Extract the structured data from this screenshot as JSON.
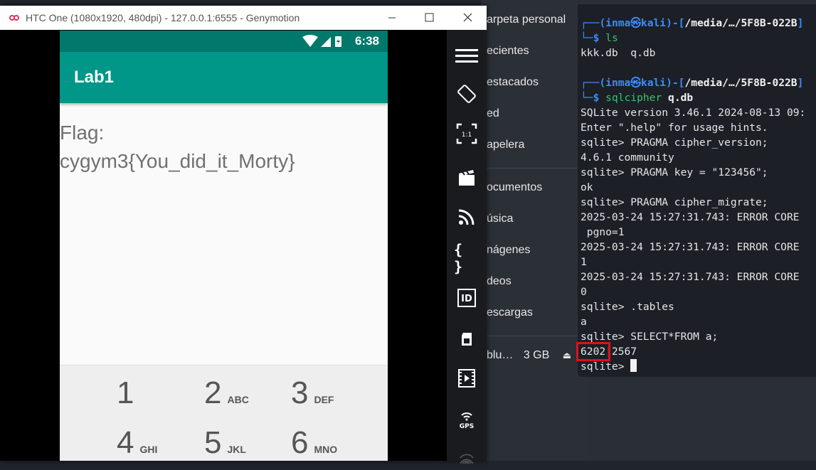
{
  "file_manager": {
    "items": [
      {
        "label": "arpeta personal"
      },
      {
        "label": "ecientes"
      },
      {
        "label": "estacados"
      },
      {
        "label": "ed"
      },
      {
        "label": "apelera"
      },
      {
        "label": "ocumentos"
      },
      {
        "label": "úsica"
      },
      {
        "label": "nágenes"
      },
      {
        "label": "deos"
      },
      {
        "label": "escargas"
      }
    ],
    "disk": {
      "label": "blu…",
      "size": "3 GB"
    }
  },
  "terminal": {
    "lines": [
      {
        "text": "kkk.db  q.db"
      },
      {
        "text": "SQLite version 3.46.1 2024-08-13 09:"
      },
      {
        "text": "Enter \".help\" for usage hints."
      },
      {
        "text": "sqlite> PRAGMA cipher_version;"
      },
      {
        "text": "4.6.1 community"
      },
      {
        "text": "sqlite> PRAGMA key = \"123456\";"
      },
      {
        "text": "ok"
      },
      {
        "text": "sqlite> PRAGMA cipher_migrate;"
      },
      {
        "text": "2025-03-24 15:27:31.743: ERROR CORE"
      },
      {
        "text": " pgno=1"
      },
      {
        "text": "2025-03-24 15:27:31.743: ERROR CORE"
      },
      {
        "text": "1"
      },
      {
        "text": "2025-03-24 15:27:31.743: ERROR CORE"
      },
      {
        "text": "0"
      },
      {
        "text": "sqlite> .tables"
      },
      {
        "text": "a"
      },
      {
        "text": "sqlite> SELECT*FROM a;"
      },
      {
        "text": "6202|2567"
      },
      {
        "text": "sqlite> "
      }
    ],
    "prompt1": {
      "user": "inma",
      "host": "kali",
      "path": "/media/…/5F8B-022B",
      "cmd": "ls"
    },
    "prompt2": {
      "user": "inma",
      "host": "kali",
      "path": "/media/…/5F8B-022B",
      "cmd": "sqlcipher",
      "arg": "q.db"
    },
    "highlight": "6202"
  },
  "genymotion": {
    "title": "HTC One (1080x1920, 480dpi) - 127.0.0.1:6555 - Genymotion",
    "toolbar_icons": [
      "menu-icon",
      "rotate-icon",
      "pixel-perfect-icon",
      "capture-icon",
      "broadcast-icon",
      "api-icon",
      "identifiers-icon",
      "sim-icon",
      "media-icon",
      "gps-icon",
      "fingerprint-icon"
    ],
    "pixel_perfect_text": "1:1",
    "gps_text": "GPS",
    "id_text": "ID"
  },
  "phone": {
    "time": "6:38",
    "app_title": "Lab1",
    "flag_label": "Flag:",
    "flag_value": "cygym3{You_did_it_Morty}",
    "keys": [
      {
        "digit": "1",
        "letters": ""
      },
      {
        "digit": "2",
        "letters": "ABC"
      },
      {
        "digit": "3",
        "letters": "DEF"
      },
      {
        "digit": "4",
        "letters": "GHI"
      },
      {
        "digit": "5",
        "letters": "JKL"
      },
      {
        "digit": "6",
        "letters": "MNO"
      }
    ]
  }
}
